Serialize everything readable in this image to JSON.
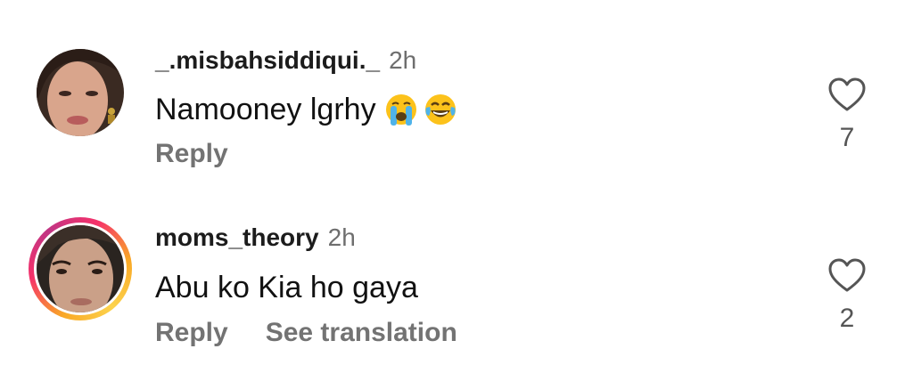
{
  "comments": [
    {
      "username": "_.misbahsiddiqui._",
      "time": "2h",
      "text": "Namooney lgrhy",
      "emojis": [
        "loudly-crying-face-emoji",
        "tears-of-joy-emoji"
      ],
      "reply_label": "Reply",
      "like_count": "7",
      "has_story_ring": false
    },
    {
      "username": "moms_theory",
      "time": "2h",
      "text": "Abu ko Kia ho gaya",
      "reply_label": "Reply",
      "see_translation_label": "See translation",
      "like_count": "2",
      "has_story_ring": true
    }
  ],
  "colors": {
    "username": "#1c1c1c",
    "secondary_text": "#737373",
    "story_ring_start": "#f9a826",
    "story_ring_end": "#c13584"
  },
  "icons": {
    "like": "heart-outline-icon"
  }
}
